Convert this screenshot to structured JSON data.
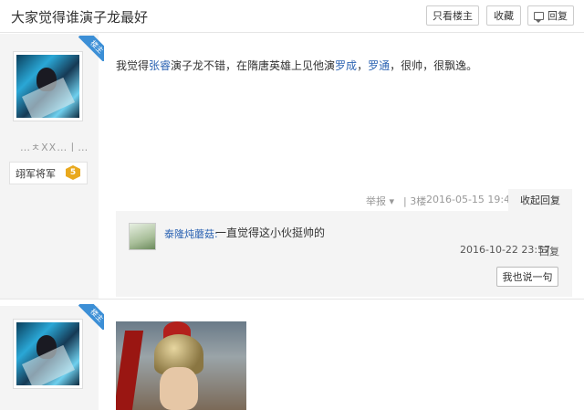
{
  "header": {
    "title": "大家觉得谁演子龙最好",
    "only_op_label": "只看楼主",
    "favorite_label": "收藏",
    "reply_label": "回复",
    "reply_icon": "comment-icon"
  },
  "post1": {
    "badge": "楼主",
    "username": "…ㅊXX…ㅣ…",
    "rank": {
      "title": "翊军将军",
      "level": "5"
    },
    "content": {
      "part1": "我觉得",
      "link1": "张睿",
      "part2": "演子龙不错，在隋唐英雄上见他演",
      "link2": "罗成",
      "part3": "，",
      "link3": "罗通",
      "part4": "，很帅，很飘逸。"
    },
    "meta": {
      "report": "举报 ▾",
      "floor": "| 3楼",
      "time": "2016-05-15 19:48",
      "collapse": "收起回复"
    },
    "reply": {
      "user": "泰隆炖蘑菇:",
      "text": "一直觉得这小伙挺帅的",
      "time": "2016-10-22 23:57",
      "reply_link": "回复",
      "say_button": "我也说一句"
    }
  },
  "post2": {
    "badge": "楼主",
    "username": "…"
  }
}
